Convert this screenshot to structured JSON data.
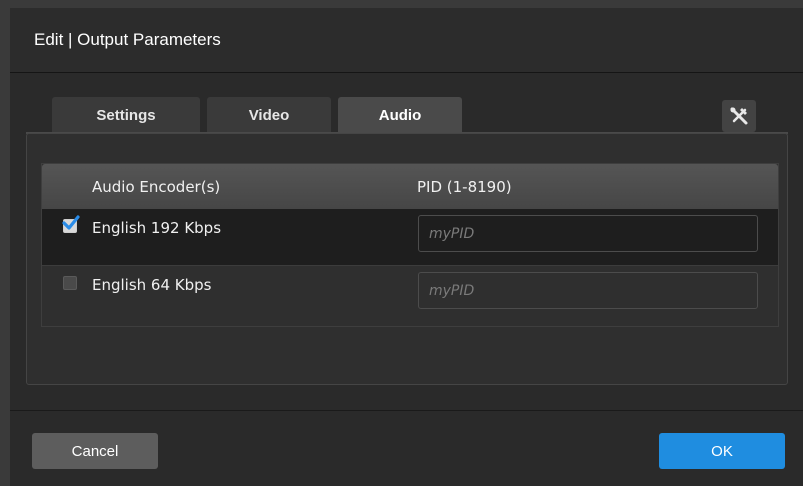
{
  "dialog": {
    "title": "Edit | Output Parameters"
  },
  "tabs": [
    {
      "label": "Settings",
      "active": false
    },
    {
      "label": "Video",
      "active": false
    },
    {
      "label": "Audio",
      "active": true
    }
  ],
  "toolbar": {
    "tools_icon": "tools-icon"
  },
  "table": {
    "headers": {
      "encoder": "Audio Encoder(s)",
      "pid": "PID (1-8190)"
    },
    "rows": [
      {
        "label": "English 192 Kbps",
        "checked": true,
        "pid_value": "",
        "pid_placeholder": "myPID"
      },
      {
        "label": "English 64 Kbps",
        "checked": false,
        "pid_value": "",
        "pid_placeholder": "myPID"
      }
    ]
  },
  "buttons": {
    "cancel": "Cancel",
    "ok": "OK"
  },
  "colors": {
    "accent": "#1f8de0",
    "check": "#2a8ce8"
  }
}
